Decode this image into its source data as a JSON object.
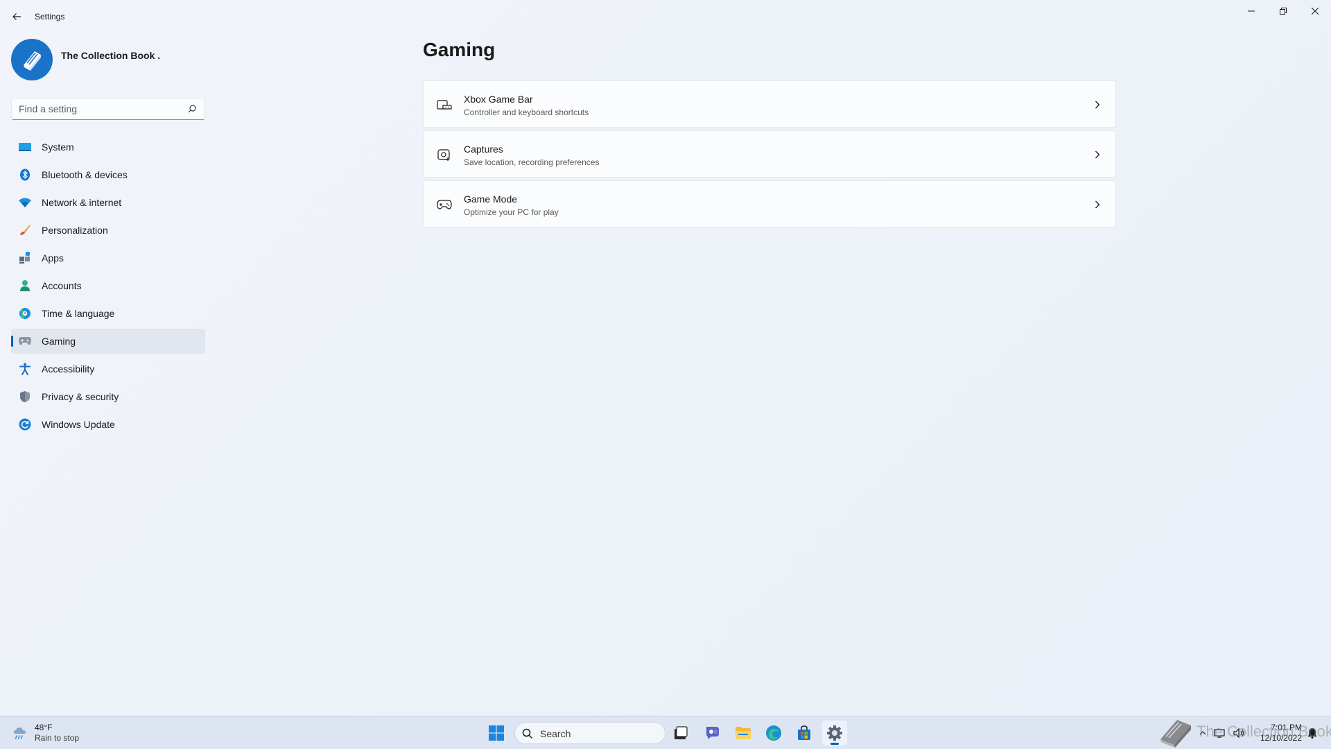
{
  "window": {
    "title": "Settings"
  },
  "profile": {
    "name": "The Collection Book ."
  },
  "search": {
    "placeholder": "Find a setting"
  },
  "sidebar": {
    "items": [
      {
        "label": "System",
        "icon": "system-icon"
      },
      {
        "label": "Bluetooth & devices",
        "icon": "bluetooth-icon"
      },
      {
        "label": "Network & internet",
        "icon": "wifi-icon"
      },
      {
        "label": "Personalization",
        "icon": "brush-icon"
      },
      {
        "label": "Apps",
        "icon": "apps-icon"
      },
      {
        "label": "Accounts",
        "icon": "accounts-icon"
      },
      {
        "label": "Time & language",
        "icon": "time-language-icon"
      },
      {
        "label": "Gaming",
        "icon": "gaming-icon",
        "selected": true
      },
      {
        "label": "Accessibility",
        "icon": "accessibility-icon"
      },
      {
        "label": "Privacy & security",
        "icon": "shield-icon"
      },
      {
        "label": "Windows Update",
        "icon": "update-icon"
      }
    ]
  },
  "main": {
    "title": "Gaming",
    "cards": [
      {
        "title": "Xbox Game Bar",
        "subtitle": "Controller and keyboard shortcuts",
        "icon": "game-bar-icon"
      },
      {
        "title": "Captures",
        "subtitle": "Save location, recording preferences",
        "icon": "captures-icon"
      },
      {
        "title": "Game Mode",
        "subtitle": "Optimize your PC for play",
        "icon": "gamepad-icon"
      }
    ]
  },
  "taskbar": {
    "weather": {
      "temp": "48°F",
      "desc": "Rain to stop"
    },
    "search_label": "Search",
    "clock": {
      "time": "7:01 PM",
      "date": "12/10/2022"
    },
    "watermark": "The Collection Book"
  },
  "colors": {
    "accent": "#005fb8",
    "background": "#eef2f9",
    "card": "#fbfcfe",
    "taskbar": "#dde5f2"
  }
}
